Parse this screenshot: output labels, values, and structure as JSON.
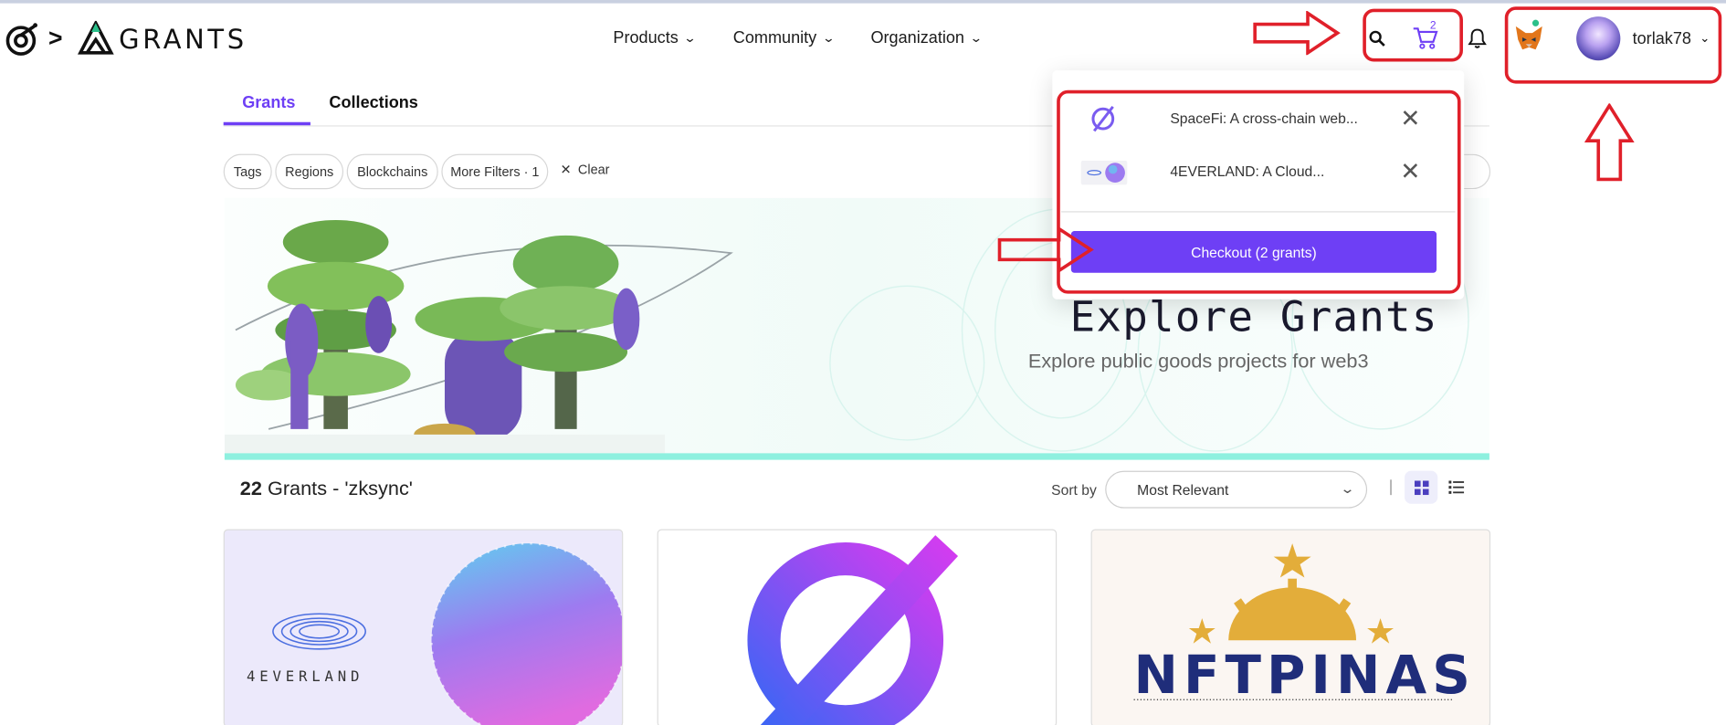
{
  "header": {
    "breadcrumb_separator": ">",
    "brand": "GRANTS",
    "nav": [
      {
        "label": "Products"
      },
      {
        "label": "Community"
      },
      {
        "label": "Organization"
      }
    ],
    "cart_count": "2",
    "username": "torlak78"
  },
  "tabs": [
    {
      "label": "Grants",
      "active": true
    },
    {
      "label": "Collections",
      "active": false
    }
  ],
  "filters": {
    "chips": [
      {
        "label": "Tags"
      },
      {
        "label": "Regions"
      },
      {
        "label": "Blockchains"
      },
      {
        "label": "More Filters · 1"
      }
    ],
    "clear_label": "Clear"
  },
  "hero": {
    "title": "Explore Grants",
    "subtitle": "Explore public goods projects for web3"
  },
  "results": {
    "count": "22",
    "label": " Grants - 'zksync'",
    "sort_label": "Sort by",
    "sort_value": "Most Relevant"
  },
  "cards": [
    {
      "name": "4EVERLAND",
      "logo_text": "4EVERLAND"
    },
    {
      "name": "SpaceFi"
    },
    {
      "name": "NFTPINAS",
      "logo_text": "NFTPINAS"
    }
  ],
  "cart": {
    "items": [
      {
        "name": "SpaceFi: A cross-chain web..."
      },
      {
        "name": "4EVERLAND: A Cloud..."
      }
    ],
    "checkout_label": "Checkout (2 grants)"
  },
  "colors": {
    "accent": "#6e3ff5",
    "annotation": "#e0202a",
    "banner_strip": "#8ef0df"
  }
}
